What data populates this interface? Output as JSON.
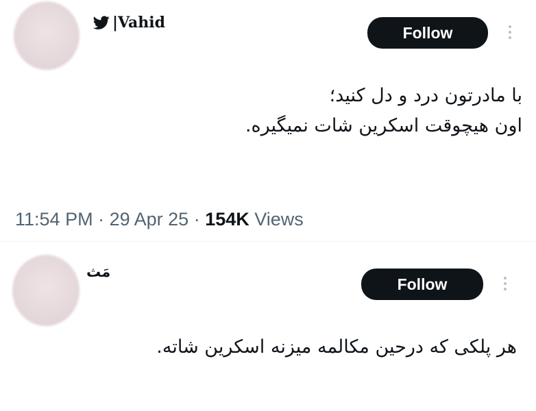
{
  "tweet": {
    "author": {
      "name": "|Vahid",
      "icon": "twitter-bird-icon"
    },
    "follow_label": "Follow",
    "text_lines": [
      "با مادرتون درد و دل کنید؛",
      "اون هیچوقت اسکرین شات نمیگیره."
    ],
    "time": "11:54 PM",
    "date": "29 Apr 25",
    "views_count": "154K",
    "views_label": "Views"
  },
  "reply": {
    "author": {
      "name": "مَث"
    },
    "follow_label": "Follow",
    "text": "هر پلکی که درحین مکالمه میزنه اسکرین شاته."
  }
}
